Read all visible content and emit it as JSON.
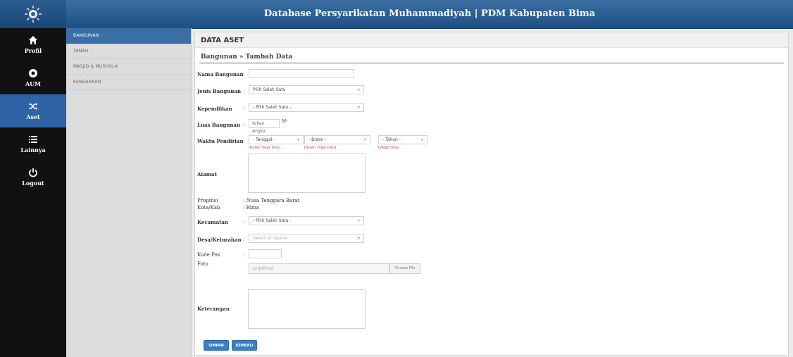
{
  "app": {
    "title": "Database Persyarikatan Muhammadiyah | PDM Kabupaten Bima"
  },
  "leftnav": [
    {
      "icon": "home-icon",
      "label": "Profil"
    },
    {
      "icon": "compass-icon",
      "label": "AUM"
    },
    {
      "icon": "shuffle-icon",
      "label": "Aset"
    },
    {
      "icon": "list-icon",
      "label": "Lainnya"
    },
    {
      "icon": "power-icon",
      "label": "Logout"
    }
  ],
  "subnav": [
    "BANGUNAN",
    "TANAH",
    "MASJID & MUSHOLA",
    "KENDARAAN"
  ],
  "panel": {
    "title": "DATA ASET",
    "breadcrumb": "Bangunan » Tambah Data"
  },
  "form": {
    "nama_label": "Nama Bangunan",
    "jenis_label": "Jenis Bangunan",
    "jenis_value": "Pilih Salah Satu",
    "kepemilikan_label": "Kepemilikan",
    "kepemilikan_value": "- Pilih Salah Satu -",
    "luas_label": "Luas Bangunan",
    "luas_placeholder": "Isikan Angka",
    "luas_unit": "M²",
    "waktu_label": "Waktu Pendirian",
    "tanggal_value": "- Tanggal -",
    "bulan_value": "- Bulan -",
    "tahun_value": "- Tahun -",
    "hint_tanggal": "[Boleh Tidak Diisi]",
    "hint_bulan": "[Boleh Tidak Diisi]",
    "hint_tahun": "[Wajib Diisi]",
    "alamat_label": "Alamat",
    "propinsi_label": "Propinsi",
    "propinsi_value": "Nusa Tenggara Barat",
    "kota_label": "Kota/Kab",
    "kota_value": "Bima",
    "kecamatan_label": "Kecamatan",
    "kecamatan_value": "- Pilih Salah Satu -",
    "desa_label": "Desa/Kelurahan",
    "desa_value": "Select an Option",
    "kodepos_label": "Kode Pos",
    "foto_label": "Foto",
    "foto_value": "undefined",
    "choose_label": "Choose File",
    "keterangan_label": "Keterangan",
    "simpan_label": "SIMPAN",
    "kembali_label": "KEMBALI"
  }
}
